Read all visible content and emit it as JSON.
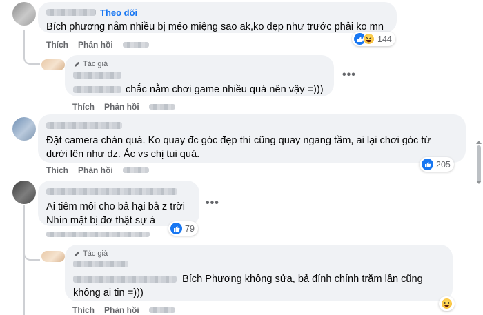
{
  "comments": [
    {
      "follow_label": "Theo dõi",
      "text": "Bích phương nằm nhiều bị méo miệng sao ak,ko đẹp như trước phải ko mn",
      "like_label": "Thích",
      "reply_label": "Phản hồi",
      "reaction_count": "144",
      "reaction_icons": [
        "like-icon",
        "haha-icon"
      ]
    },
    {
      "is_reply": true,
      "author_badge": "Tác giả",
      "text": "chắc nằm chơi game nhiều quá nên vậy =)))",
      "like_label": "Thích",
      "reply_label": "Phản hồi"
    },
    {
      "text_line1": "Đặt camera chán quá. Ko quay đc góc đẹp thì cũng quay ngang tầm, ai lại chơi góc từ",
      "text_line2": "dưới lên như dz. Ác vs chị tui quá.",
      "like_label": "Thích",
      "reply_label": "Phản hồi",
      "reaction_count": "205",
      "reaction_icons": [
        "like-icon"
      ]
    },
    {
      "text_line1": "Ai tiêm môi cho bả hại bả z trời",
      "text_line2": "Nhìn mặt bị đơ thật sự á",
      "reaction_count": "79",
      "reaction_icons": [
        "like-icon"
      ]
    },
    {
      "is_reply": true,
      "author_badge": "Tác giả",
      "text_line1": "Bích Phương không sửa, bả đính chính trăm lần cũng",
      "text_line2": "không ai tin =)))",
      "like_label": "Thích",
      "reply_label": "Phản hồi",
      "reaction_icons": [
        "haha-icon"
      ]
    }
  ],
  "more_label": "•••",
  "colors": {
    "accent": "#1877f2",
    "bubble": "#f0f2f5",
    "muted": "#65676b"
  }
}
